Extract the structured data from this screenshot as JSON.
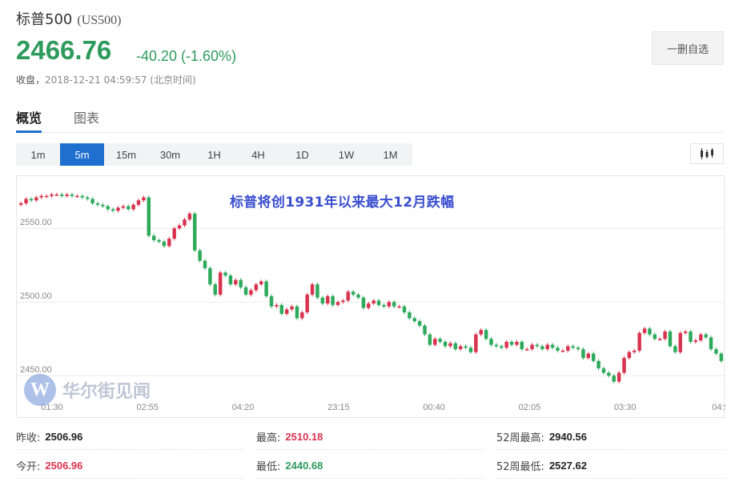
{
  "header": {
    "name": "标普500",
    "code": "(US500)",
    "price": "2466.76",
    "change": "-40.20 (-1.60%)",
    "status_label": "收盘，",
    "timestamp": "2018-12-21 04:59:57 (北京时间)",
    "watch_button": "一删自选"
  },
  "tabs": [
    {
      "label": "概览",
      "active": true
    },
    {
      "label": "图表",
      "active": false
    }
  ],
  "periods": [
    "1m",
    "5m",
    "15m",
    "30m",
    "1H",
    "4H",
    "1D",
    "1W",
    "1M"
  ],
  "active_period": "5m",
  "chart_type_icon": "candlestick-icon",
  "headline": "标普将创1931年以来最大12月跌幅",
  "watermark": {
    "logo": "W",
    "name": "华尔街见闻"
  },
  "colors": {
    "up": "#d9344f",
    "down": "#2eaa5c",
    "accent": "#1f6fd0"
  },
  "chart_data": {
    "type": "candlestick",
    "y_ticks": [
      "2550.00",
      "2500.00",
      "2450.00"
    ],
    "y_tick_values": [
      2550,
      2500,
      2450
    ],
    "x_ticks": [
      "01:30",
      "02:55",
      "04:20",
      "23:15",
      "00:40",
      "02:05",
      "03:30",
      "04:5"
    ],
    "ylim": [
      2436,
      2580
    ],
    "grid": true,
    "closes": [
      2567,
      2570,
      2569,
      2571,
      2572,
      2572,
      2573,
      2573,
      2572,
      2573,
      2572,
      2572,
      2571,
      2570,
      2567,
      2566,
      2565,
      2563,
      2562,
      2564,
      2565,
      2563,
      2566,
      2569,
      2571,
      2545,
      2542,
      2541,
      2538,
      2543,
      2550,
      2552,
      2556,
      2560,
      2535,
      2528,
      2523,
      2512,
      2505,
      2520,
      2518,
      2512,
      2515,
      2510,
      2505,
      2508,
      2512,
      2514,
      2504,
      2497,
      2498,
      2492,
      2495,
      2497,
      2489,
      2493,
      2505,
      2512,
      2503,
      2499,
      2504,
      2498,
      2500,
      2501,
      2507,
      2505,
      2503,
      2496,
      2499,
      2501,
      2498,
      2497,
      2500,
      2497,
      2497,
      2493,
      2489,
      2487,
      2484,
      2478,
      2471,
      2475,
      2473,
      2470,
      2472,
      2468,
      2470,
      2469,
      2466,
      2478,
      2481,
      2475,
      2471,
      2470,
      2469,
      2473,
      2471,
      2473,
      2468,
      2468,
      2471,
      2470,
      2468,
      2471,
      2469,
      2467,
      2467,
      2470,
      2469,
      2468,
      2462,
      2465,
      2460,
      2455,
      2452,
      2450,
      2446,
      2452,
      2462,
      2466,
      2467,
      2479,
      2482,
      2478,
      2475,
      2475,
      2480,
      2470,
      2466,
      2479,
      2480,
      2473,
      2474,
      2478,
      2476,
      2468,
      2465,
      2460
    ]
  },
  "stats": [
    {
      "label": "昨收:",
      "value": "2506.96",
      "tone": "neutral"
    },
    {
      "label": "最高:",
      "value": "2510.18",
      "tone": "up"
    },
    {
      "label": "52周最高:",
      "value": "2940.56",
      "tone": "neutral"
    },
    {
      "label": "今开:",
      "value": "2506.96",
      "tone": "up"
    },
    {
      "label": "最低:",
      "value": "2440.68",
      "tone": "down"
    },
    {
      "label": "52周最低:",
      "value": "2527.62",
      "tone": "neutral"
    }
  ]
}
